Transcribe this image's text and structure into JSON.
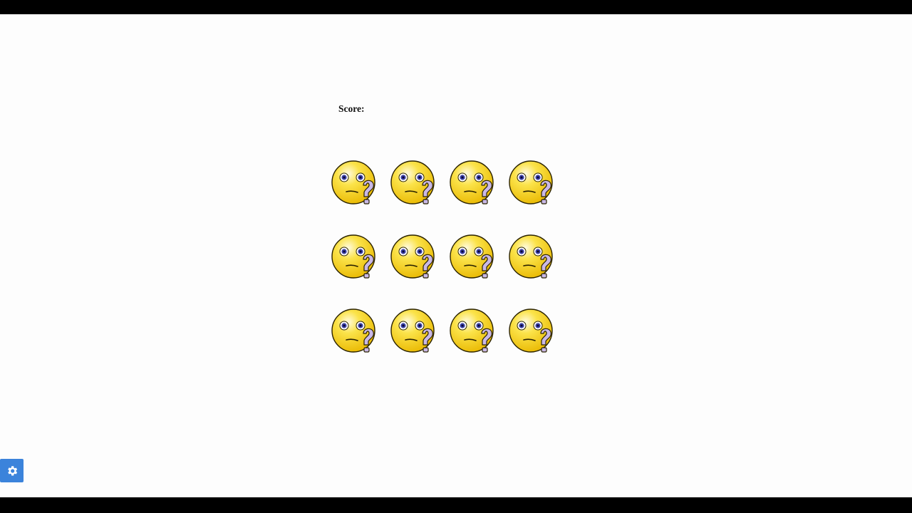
{
  "score": {
    "label": "Score:",
    "value": ""
  },
  "cards": [
    {
      "state": "hidden",
      "icon": "confused-face-question-icon"
    },
    {
      "state": "hidden",
      "icon": "confused-face-question-icon"
    },
    {
      "state": "hidden",
      "icon": "confused-face-question-icon"
    },
    {
      "state": "hidden",
      "icon": "confused-face-question-icon"
    },
    {
      "state": "hidden",
      "icon": "confused-face-question-icon"
    },
    {
      "state": "hidden",
      "icon": "confused-face-question-icon"
    },
    {
      "state": "hidden",
      "icon": "confused-face-question-icon"
    },
    {
      "state": "hidden",
      "icon": "confused-face-question-icon"
    },
    {
      "state": "hidden",
      "icon": "confused-face-question-icon"
    },
    {
      "state": "hidden",
      "icon": "confused-face-question-icon"
    },
    {
      "state": "hidden",
      "icon": "confused-face-question-icon"
    },
    {
      "state": "hidden",
      "icon": "confused-face-question-icon"
    }
  ],
  "settings": {
    "icon": "gear-icon"
  },
  "colors": {
    "page_bg": "#fdfdfd",
    "letterbox": "#000000",
    "face_yellow": "#f6d21a",
    "question_purple": "#c9b8e6",
    "settings_blue": "#3b83db"
  }
}
